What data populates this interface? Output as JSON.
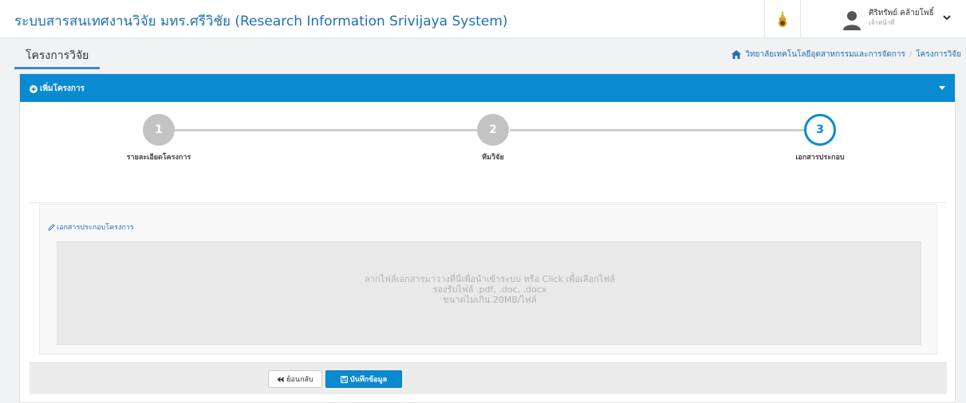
{
  "header": {
    "app_title": "ระบบสารสนเทศงานวิจัย มทร.ศรีวิชัย (Research Information Srivijaya System)",
    "user_name": "ศิริทรัพย์ คล้ายโพธิ์",
    "user_role": "เจ้าหน้าที่"
  },
  "page": {
    "title": "โครงการวิจัย",
    "breadcrumb": {
      "home": "วิทยาลัยเทคโนโลยีอุตสาหกรรมและการจัดการ",
      "separator": "/",
      "current": "โครงการวิจัย"
    }
  },
  "panel": {
    "title": "เพิ่มโครงการ",
    "steps": [
      {
        "number": "1",
        "label": "รายละเอียดโครงการ",
        "state": "completed"
      },
      {
        "number": "2",
        "label": "ทีมวิจัย",
        "state": "completed"
      },
      {
        "number": "3",
        "label": "เอกสารประกอบ",
        "state": "active"
      }
    ],
    "attachments": {
      "label": "เอกสารประกอบโครงการ",
      "dropzone_line1": "ลากไฟล์เอกสารมาวางที่นี่เพื่อนำเข้าระบบ หรือ Click เพื่อเลือกไฟล์",
      "dropzone_line2": "รองรับไฟล์ .pdf, .doc, .docx",
      "dropzone_line3": "ขนาดไม่เกิน 20MB/ไฟล์"
    },
    "buttons": {
      "back": "ย้อนกลับ",
      "save": "บันทึกข้อมูล"
    }
  },
  "colors": {
    "primary": "#0a8ad1",
    "link": "#1f6fb2",
    "step_inactive": "#c3c3c3"
  },
  "icons": {
    "logo": "university-emblem-icon",
    "avatar": "user-icon",
    "user_menu": "chevron-down-icon",
    "home": "home-icon",
    "panel_add": "plus-circle-icon",
    "panel_toggle": "caret-down-icon",
    "attachment": "pencil-icon",
    "back": "backward-icon",
    "save": "save-icon"
  }
}
